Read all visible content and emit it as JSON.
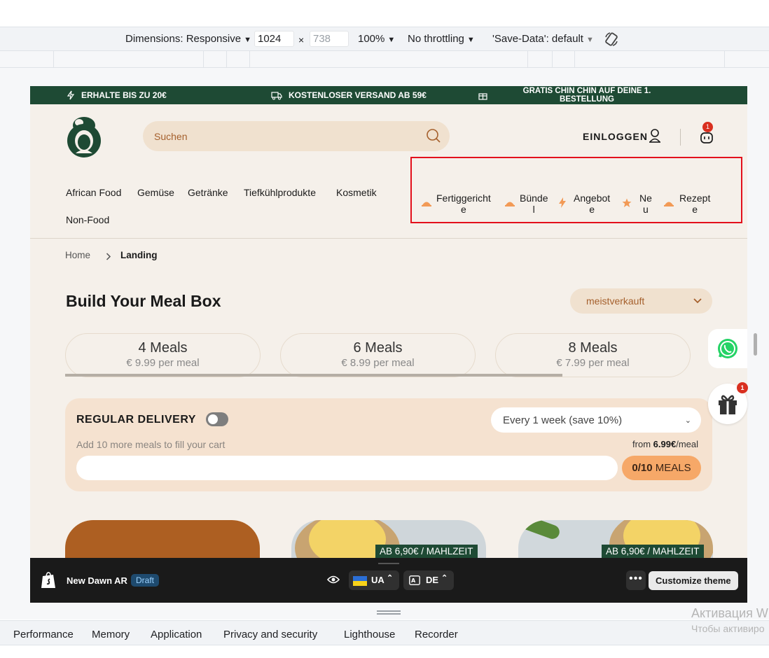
{
  "devtools": {
    "dimensions_label": "Dimensions: Responsive",
    "width": "1024",
    "height_placeholder": "738",
    "zoom": "100%",
    "throttling": "No throttling",
    "save_data": "'Save-Data': default",
    "tabs": [
      "Performance",
      "Memory",
      "Application",
      "Privacy and security",
      "Lighthouse",
      "Recorder"
    ]
  },
  "announcement": {
    "item1": "ERHALTE BIS ZU 20€",
    "item2": "KOSTENLOSER VERSAND AB 59€",
    "item3": "GRATIS CHIN CHIN AUF DEINE 1. BESTELLUNG"
  },
  "header": {
    "search_placeholder": "Suchen",
    "login": "EINLOGGEN",
    "cart_count": "1"
  },
  "nav": {
    "primary": [
      "African Food",
      "Gemüse",
      "Getränke",
      "Tiefkühlprodukte",
      "Kosmetik",
      "Non-Food"
    ],
    "secondary": [
      {
        "line1": "Fertiggericht",
        "line2": "e"
      },
      {
        "line1": "Bünde",
        "line2": "l"
      },
      {
        "line1": "Angebot",
        "line2": "e"
      },
      {
        "line1": "Ne",
        "line2": "u"
      },
      {
        "line1": "Rezept",
        "line2": "e"
      }
    ]
  },
  "breadcrumb": {
    "home": "Home",
    "current": "Landing"
  },
  "main": {
    "title": "Build Your Meal Box",
    "sort": "meistverkauft",
    "plans": [
      {
        "title": "4 Meals",
        "price": "€ 9.99 per meal"
      },
      {
        "title": "6 Meals",
        "price": "€ 8.99 per meal"
      },
      {
        "title": "8 Meals",
        "price": "€ 7.99 per meal"
      }
    ],
    "delivery": {
      "heading": "REGULAR DELIVERY",
      "frequency": "Every 1 week (save 10%)",
      "hint": "Add 10 more meals to fill your cart",
      "from_prefix": "from ",
      "from_price": "6.99€",
      "from_suffix": "/meal",
      "count": "0/10",
      "count_label": " MEALS"
    },
    "product_tag": "AB 6,90€ / MAHLZEIT"
  },
  "floating": {
    "gift_count": "1"
  },
  "shopify_bar": {
    "theme_name": "New Dawn AR",
    "status": "Draft",
    "country": "UA",
    "language": "DE",
    "customize": "Customize theme"
  },
  "windows_overlay": {
    "line1": "Активация W",
    "line2": "Чтобы активиро"
  },
  "colors": {
    "brand_green": "#1e4a34",
    "accent_orange": "#f6a868",
    "highlight_red": "#e3101c"
  }
}
